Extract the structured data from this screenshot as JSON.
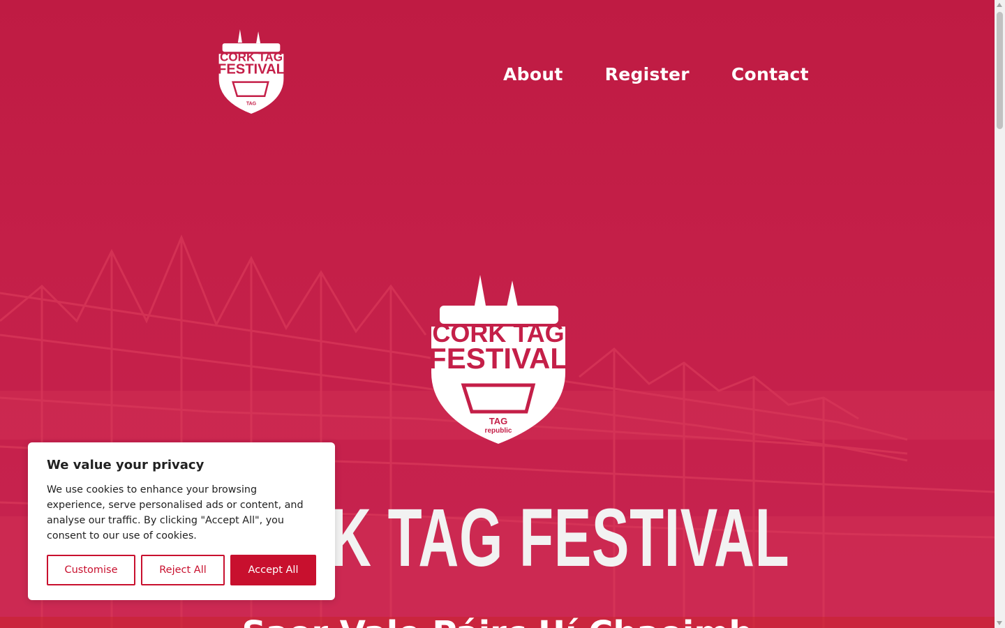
{
  "nav": {
    "items": [
      {
        "label": "About"
      },
      {
        "label": "Register"
      },
      {
        "label": "Contact"
      }
    ]
  },
  "logo": {
    "line1": "CORK TAG",
    "line2": "FESTIVAL",
    "badge_top": "TAG",
    "badge_bottom": "republic"
  },
  "hero": {
    "title": "CORK TAG FESTIVAL",
    "subtitle": "Saor Vale Páirc Uí Chaoimh"
  },
  "cookie_banner": {
    "title": "We value your privacy",
    "body": "We use cookies to enhance your browsing experience, serve personalised ads or content, and analyse our traffic. By clicking \"Accept All\", you consent to our use of cookies.",
    "customise": "Customise",
    "reject": "Reject All",
    "accept": "Accept All"
  },
  "colors": {
    "brand": "#c8102e",
    "hero_bg": "#bf1b43",
    "text_light": "#ffffff"
  }
}
